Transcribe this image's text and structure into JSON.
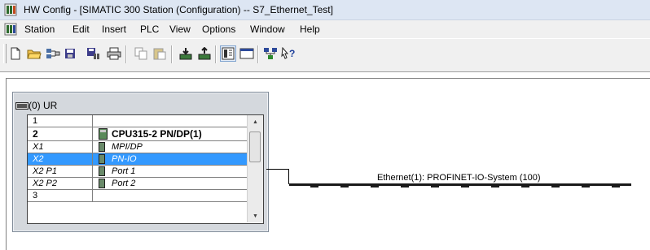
{
  "window": {
    "title": "HW Config - [SIMATIC 300 Station (Configuration) -- S7_Ethernet_Test]",
    "app_icon": "hw-config-icon"
  },
  "menu": {
    "doc_icon": "station-doc-icon",
    "items": [
      "Station",
      "Edit",
      "Insert",
      "PLC",
      "View",
      "Options",
      "Window",
      "Help"
    ]
  },
  "toolbar": {
    "buttons": [
      "new-icon",
      "open-icon",
      "network-open-icon",
      "save-icon",
      "save-compile-icon",
      "print-icon",
      "copy-icon",
      "paste-icon",
      "download-icon",
      "upload-icon",
      "catalog-icon",
      "module-view-icon",
      "network-view-icon",
      "help-pointer-icon"
    ],
    "pressed": "catalog-icon"
  },
  "rack": {
    "title": "(0) UR",
    "rows": [
      {
        "slot": "1",
        "module": ""
      },
      {
        "slot": "2",
        "module": "CPU315-2 PN/DP(1)"
      },
      {
        "slot": "X1",
        "module": "MPI/DP"
      },
      {
        "slot": "X2",
        "module": "PN-IO"
      },
      {
        "slot": "X2 P1",
        "module": "Port 1"
      },
      {
        "slot": "X2 P2",
        "module": "Port 2"
      },
      {
        "slot": "3",
        "module": ""
      }
    ],
    "selected_row": "X2"
  },
  "network": {
    "label": "Ethernet(1): PROFINET-IO-System (100)"
  }
}
